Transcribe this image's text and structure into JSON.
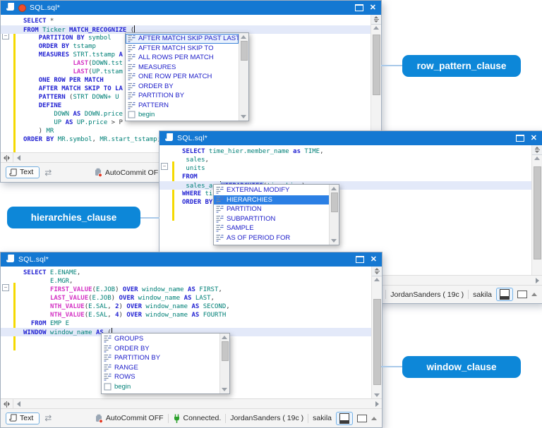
{
  "colors": {
    "titlebar": "#1478d2",
    "callout_bg": "#0d87d8",
    "connector_line": "#a9c9e9",
    "selection_blue": "#2b7fe4",
    "keyword": "#2222d2",
    "identifier": "#008077",
    "function": "#d433c4",
    "change_bar_yellow": "#f5d900"
  },
  "status": {
    "text_button": "Text",
    "autocommit": "AutoCommit OFF",
    "connected": "Connected.",
    "user": "JordanSanders ( 19c )",
    "database": "sakila"
  },
  "windows": [
    {
      "title": "SQL.sql*",
      "modified": true,
      "code": [
        {
          "tokens": [
            [
              "kw",
              "SELECT"
            ],
            [
              "pl",
              " *"
            ]
          ]
        },
        {
          "current": true,
          "tokens": [
            [
              "kw",
              "FROM"
            ],
            [
              "id",
              " Ticker"
            ],
            [
              "kw",
              " MATCH_RECOGNIZE"
            ],
            [
              "pl",
              " ("
            ],
            [
              "cursor",
              ""
            ]
          ]
        },
        {
          "tokens": [
            [
              "pl",
              "    "
            ],
            [
              "kw",
              "PARTITION BY"
            ],
            [
              "id",
              " symbol"
            ]
          ]
        },
        {
          "tokens": [
            [
              "pl",
              "    "
            ],
            [
              "kw",
              "ORDER BY"
            ],
            [
              "id",
              " tstamp"
            ]
          ]
        },
        {
          "tokens": [
            [
              "pl",
              "    "
            ],
            [
              "kw",
              "MEASURES"
            ],
            [
              "id",
              " STRT.tstamp"
            ],
            [
              "kw",
              " A"
            ]
          ]
        },
        {
          "tokens": [
            [
              "pl",
              "             "
            ],
            [
              "fn",
              "LAST"
            ],
            [
              "pl",
              "("
            ],
            [
              "id",
              "DOWN.tst"
            ]
          ]
        },
        {
          "tokens": [
            [
              "pl",
              "             "
            ],
            [
              "fn",
              "LAST"
            ],
            [
              "pl",
              "("
            ],
            [
              "id",
              "UP.tstam"
            ]
          ]
        },
        {
          "tokens": [
            [
              "pl",
              "    "
            ],
            [
              "kw",
              "ONE ROW PER MATCH"
            ]
          ]
        },
        {
          "tokens": [
            [
              "pl",
              "    "
            ],
            [
              "kw",
              "AFTER MATCH SKIP TO LA"
            ]
          ]
        },
        {
          "tokens": [
            [
              "pl",
              "    "
            ],
            [
              "kw",
              "PATTERN"
            ],
            [
              "pl",
              " ("
            ],
            [
              "id",
              "STRT DOWN+ U"
            ]
          ]
        },
        {
          "tokens": [
            [
              "pl",
              "    "
            ],
            [
              "kw",
              "DEFINE"
            ]
          ]
        },
        {
          "tokens": [
            [
              "pl",
              "        "
            ],
            [
              "id",
              "DOWN"
            ],
            [
              "kw",
              " AS"
            ],
            [
              "id",
              " DOWN.price"
            ]
          ]
        },
        {
          "tokens": [
            [
              "pl",
              "        "
            ],
            [
              "id",
              "UP"
            ],
            [
              "kw",
              " AS"
            ],
            [
              "id",
              " UP.price"
            ],
            [
              "pl",
              " > P"
            ]
          ]
        },
        {
          "tokens": [
            [
              "pl",
              "    ) "
            ],
            [
              "id",
              "MR"
            ]
          ]
        },
        {
          "tokens": [
            [
              "kw",
              "ORDER BY"
            ],
            [
              "id",
              " MR.symbol"
            ],
            [
              "pl",
              ","
            ],
            [
              "id",
              " MR.start_tstamp"
            ],
            [
              "pl",
              ";"
            ]
          ]
        }
      ],
      "completion": {
        "items": [
          {
            "label": "AFTER MATCH SKIP PAST LAST ROW",
            "icon": "list-icon",
            "state": "focused"
          },
          {
            "label": "AFTER MATCH SKIP TO",
            "icon": "list-icon"
          },
          {
            "label": "ALL ROWS PER MATCH",
            "icon": "list-icon"
          },
          {
            "label": "MEASURES",
            "icon": "list-icon"
          },
          {
            "label": "ONE ROW PER MATCH",
            "icon": "list-icon"
          },
          {
            "label": "ORDER BY",
            "icon": "list-icon"
          },
          {
            "label": "PARTITION BY",
            "icon": "list-icon"
          },
          {
            "label": "PATTERN",
            "icon": "list-icon"
          },
          {
            "label": "begin",
            "icon": "template-icon"
          }
        ]
      }
    },
    {
      "title": "SQL.sql*",
      "modified": false,
      "code": [
        {
          "tokens": [
            [
              "kw",
              "SELECT"
            ],
            [
              "id",
              " time_hier.member_name"
            ],
            [
              "kw",
              " as"
            ],
            [
              "id",
              " TIME"
            ],
            [
              "pl",
              ","
            ]
          ]
        },
        {
          "tokens": [
            [
              "id",
              " sales"
            ],
            [
              "pl",
              ","
            ]
          ]
        },
        {
          "tokens": [
            [
              "id",
              " units"
            ]
          ]
        },
        {
          "tokens": [
            [
              "kw",
              "FROM"
            ]
          ]
        },
        {
          "current": true,
          "tokens": [
            [
              "id",
              " sales_av "
            ],
            [
              "cursor",
              ""
            ],
            [
              "boxkw",
              "HIERARCHIES"
            ],
            [
              "pl",
              "("
            ],
            [
              "id",
              "time_hier"
            ],
            [
              "pl",
              ")"
            ]
          ]
        },
        {
          "tokens": [
            [
              "kw",
              "WHERE"
            ],
            [
              "id",
              " ti"
            ]
          ]
        },
        {
          "tokens": [
            [
              "kw",
              "ORDER BY"
            ]
          ]
        }
      ],
      "completion": {
        "items": [
          {
            "label": "EXTERNAL MODIFY",
            "icon": "list-icon"
          },
          {
            "label": "HIERARCHIES",
            "icon": "list-icon",
            "state": "selected"
          },
          {
            "label": "PARTITION",
            "icon": "list-icon"
          },
          {
            "label": "SUBPARTITION",
            "icon": "list-icon"
          },
          {
            "label": "SAMPLE",
            "icon": "list-icon"
          },
          {
            "label": "AS OF PERIOD FOR",
            "icon": "list-icon"
          }
        ]
      }
    },
    {
      "title": "SQL.sql*",
      "modified": false,
      "code": [
        {
          "tokens": [
            [
              "kw",
              "SELECT"
            ],
            [
              "id",
              " E.ENAME"
            ],
            [
              "pl",
              ","
            ]
          ]
        },
        {
          "tokens": [
            [
              "pl",
              "       "
            ],
            [
              "id",
              "E.MGR"
            ],
            [
              "pl",
              ","
            ]
          ]
        },
        {
          "tokens": [
            [
              "pl",
              "       "
            ],
            [
              "fn",
              "FIRST_VALUE"
            ],
            [
              "pl",
              "("
            ],
            [
              "id",
              "E.JOB"
            ],
            [
              "pl",
              ")"
            ],
            [
              "kw",
              " OVER"
            ],
            [
              "id",
              " window_name"
            ],
            [
              "kw",
              " AS"
            ],
            [
              "id",
              " FIRST"
            ],
            [
              "pl",
              ","
            ]
          ]
        },
        {
          "tokens": [
            [
              "pl",
              "       "
            ],
            [
              "fn",
              "LAST_VALUE"
            ],
            [
              "pl",
              "("
            ],
            [
              "id",
              "E.JOB"
            ],
            [
              "pl",
              ")"
            ],
            [
              "kw",
              " OVER"
            ],
            [
              "id",
              " window_name"
            ],
            [
              "kw",
              " AS"
            ],
            [
              "id",
              " LAST"
            ],
            [
              "pl",
              ","
            ]
          ]
        },
        {
          "tokens": [
            [
              "pl",
              "       "
            ],
            [
              "fn",
              "NTH_VALUE"
            ],
            [
              "pl",
              "("
            ],
            [
              "id",
              "E.SAL"
            ],
            [
              "pl",
              ", "
            ],
            [
              "num",
              "2"
            ],
            [
              "pl",
              ")"
            ],
            [
              "kw",
              " OVER"
            ],
            [
              "id",
              " window_name"
            ],
            [
              "kw",
              " AS"
            ],
            [
              "id",
              " SECOND"
            ],
            [
              "pl",
              ","
            ]
          ]
        },
        {
          "tokens": [
            [
              "pl",
              "       "
            ],
            [
              "fn",
              "NTH_VALUE"
            ],
            [
              "pl",
              "("
            ],
            [
              "id",
              "E.SAL"
            ],
            [
              "pl",
              ", "
            ],
            [
              "num",
              "4"
            ],
            [
              "pl",
              ")"
            ],
            [
              "kw",
              " OVER"
            ],
            [
              "id",
              " window_name"
            ],
            [
              "kw",
              " AS"
            ],
            [
              "id",
              " FOURTH"
            ]
          ]
        },
        {
          "tokens": [
            [
              "pl",
              "  "
            ],
            [
              "kw",
              "FROM"
            ],
            [
              "id",
              " EMP E"
            ]
          ]
        },
        {
          "current": true,
          "tokens": [
            [
              "kw",
              "WINDOW"
            ],
            [
              "id",
              " window_name"
            ],
            [
              "kw",
              " AS"
            ],
            [
              "pl",
              " ("
            ],
            [
              "cursor",
              ""
            ]
          ]
        }
      ],
      "completion": {
        "items": [
          {
            "label": "GROUPS",
            "icon": "list-icon"
          },
          {
            "label": "ORDER BY",
            "icon": "list-icon"
          },
          {
            "label": "PARTITION BY",
            "icon": "list-icon"
          },
          {
            "label": "RANGE",
            "icon": "list-icon"
          },
          {
            "label": "ROWS",
            "icon": "list-icon"
          },
          {
            "label": "begin",
            "icon": "template-icon"
          }
        ]
      }
    }
  ],
  "callouts": [
    {
      "text": "row_pattern_clause"
    },
    {
      "text": "hierarchies_clause"
    },
    {
      "text": "window_clause"
    }
  ]
}
